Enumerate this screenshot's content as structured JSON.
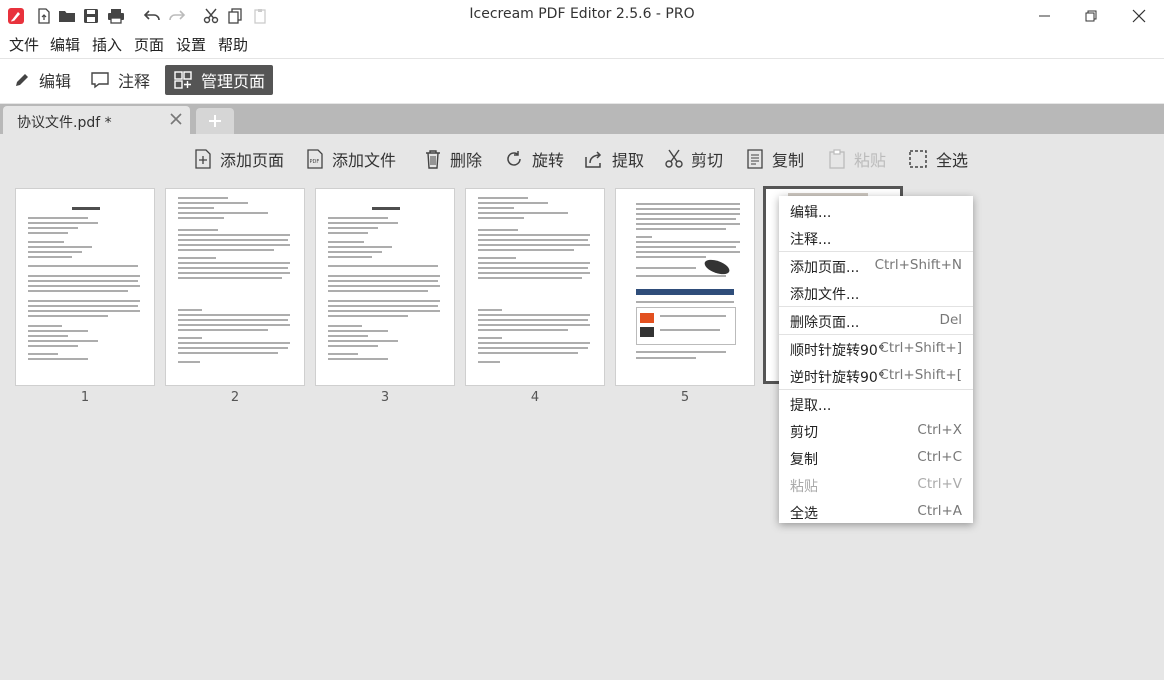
{
  "window": {
    "title": "Icecream PDF Editor 2.5.6 - PRO"
  },
  "menubar": {
    "items": [
      "文件",
      "编辑",
      "插入",
      "页面",
      "设置",
      "帮助"
    ]
  },
  "modes": {
    "edit": "编辑",
    "annotate": "注释",
    "manage": "管理页面"
  },
  "tab": {
    "label": "协议文件.pdf *"
  },
  "toolbar": {
    "add_page": "添加页面",
    "add_file": "添加文件",
    "delete": "删除",
    "rotate": "旋转",
    "extract": "提取",
    "cut": "剪切",
    "copy": "复制",
    "paste": "粘贴",
    "select_all": "全选",
    "pdf_badge": "PDF"
  },
  "pages": [
    {
      "number": "1"
    },
    {
      "number": "2"
    },
    {
      "number": "3"
    },
    {
      "number": "4"
    },
    {
      "number": "5"
    }
  ],
  "context_menu": {
    "items": [
      {
        "label": "编辑...",
        "shortcut": ""
      },
      {
        "label": "注释...",
        "shortcut": ""
      },
      {
        "label": "添加页面...",
        "shortcut": "Ctrl+Shift+N"
      },
      {
        "label": "添加文件...",
        "shortcut": ""
      },
      {
        "label": "删除页面...",
        "shortcut": "Del"
      },
      {
        "label": "顺时针旋转90°",
        "shortcut": "Ctrl+Shift+]"
      },
      {
        "label": "逆时针旋转90°",
        "shortcut": "Ctrl+Shift+["
      },
      {
        "label": "提取...",
        "shortcut": ""
      },
      {
        "label": "剪切",
        "shortcut": "Ctrl+X"
      },
      {
        "label": "复制",
        "shortcut": "Ctrl+C"
      },
      {
        "label": "粘贴",
        "shortcut": "Ctrl+V"
      },
      {
        "label": "全选",
        "shortcut": "Ctrl+A"
      }
    ]
  },
  "colors": {
    "brand": "#e8323c",
    "active_mode_bg": "#555555",
    "tabstrip_bg": "#b8b8b8",
    "workspace_bg": "#e6e6e6"
  }
}
